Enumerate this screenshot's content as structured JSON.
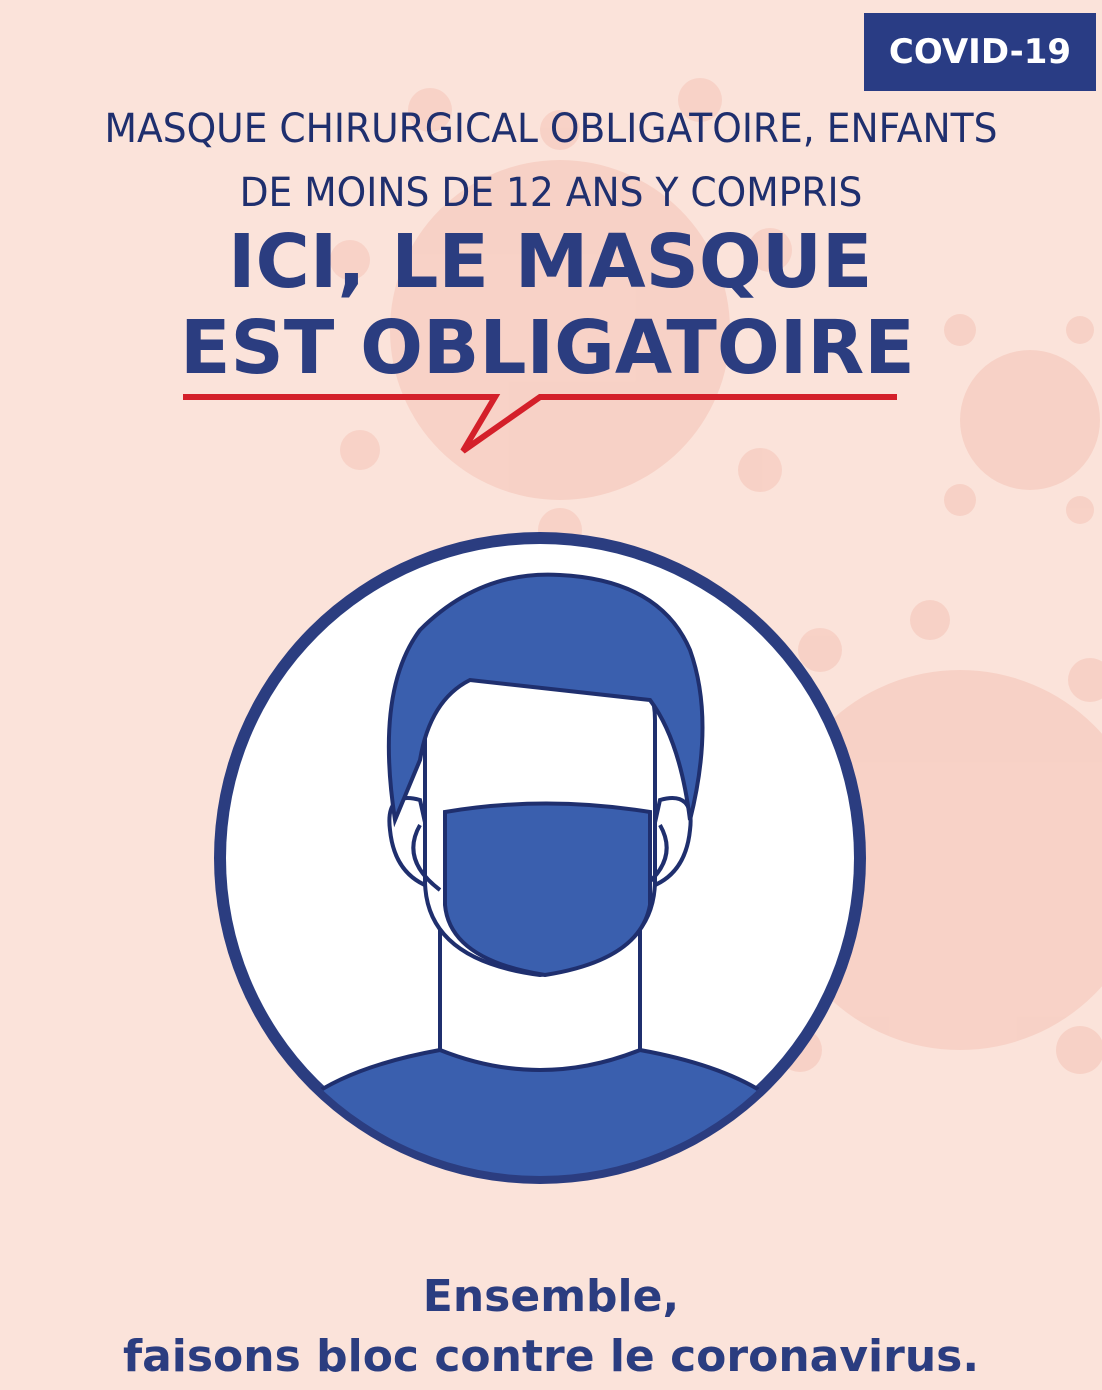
{
  "badge": {
    "label": "COVID-19"
  },
  "header": {
    "line1": "MASQUE CHIRURGICAL OBLIGATOIRE, ENFANTS",
    "line2": "DE MOINS DE 12 ANS Y COMPRIS"
  },
  "headline": {
    "line1": "ICI, LE MASQUE",
    "line2": "EST OBLIGATOIRE"
  },
  "footer": {
    "line1": "Ensemble,",
    "line2": "faisons bloc contre le coronavirus."
  },
  "colors": {
    "background": "#fbe3da",
    "navy": "#2b3d80",
    "blue": "#3a5fae",
    "red": "#d4202a",
    "virus": "#f7cfc3"
  },
  "icons": {
    "pictogram": "masked-person-icon",
    "background": "virus-icon"
  }
}
